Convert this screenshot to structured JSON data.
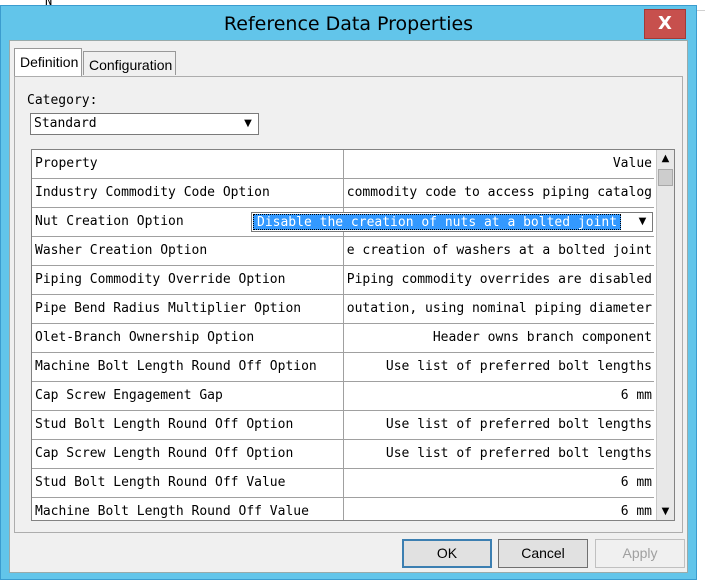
{
  "dialog": {
    "title": "Reference Data Properties",
    "close_label": "X"
  },
  "tabs": [
    {
      "label": "Definition",
      "active": true
    },
    {
      "label": "Configuration",
      "active": false
    }
  ],
  "category": {
    "label": "Category:",
    "value": "Standard"
  },
  "grid": {
    "headers": {
      "property": "Property",
      "value": "Value"
    },
    "rows": [
      {
        "property": "Industry Commodity Code Option",
        "value": "commodity code to access piping catalog"
      },
      {
        "property": "Nut Creation Option",
        "value": "Disable the creation of nuts at a bolted joint",
        "editing": true
      },
      {
        "property": "Washer Creation Option",
        "value": "e creation of washers at a bolted joint"
      },
      {
        "property": "Piping Commodity Override Option",
        "value": "Piping commodity overrides are disabled"
      },
      {
        "property": "Pipe Bend Radius Multiplier Option",
        "value": "outation, using nominal piping diameter"
      },
      {
        "property": "Olet-Branch Ownership Option",
        "value": "Header owns branch component"
      },
      {
        "property": "Machine Bolt Length Round Off Option",
        "value": "Use list of preferred bolt lengths"
      },
      {
        "property": "Cap Screw Engagement Gap",
        "value": "6 mm"
      },
      {
        "property": "Stud Bolt Length Round Off Option",
        "value": "Use list of preferred bolt lengths"
      },
      {
        "property": "Cap Screw Length Round Off Option",
        "value": "Use list of preferred bolt lengths"
      },
      {
        "property": "Stud Bolt Length Round Off Value",
        "value": "6 mm"
      },
      {
        "property": "Machine Bolt Length Round Off Value",
        "value": "6 mm"
      }
    ]
  },
  "buttons": {
    "ok": "OK",
    "cancel": "Cancel",
    "apply": "Apply"
  }
}
